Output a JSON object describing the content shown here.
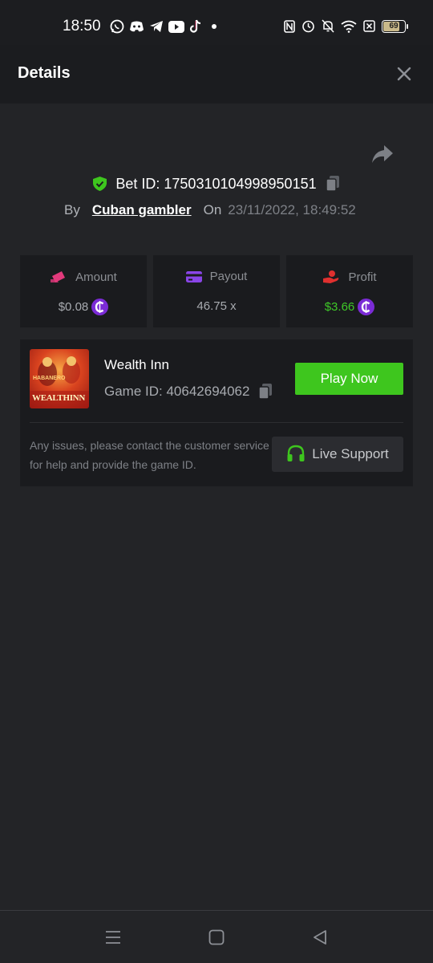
{
  "status_bar": {
    "time": "18:50",
    "battery": "69",
    "app_icons": [
      "whatsapp-icon",
      "discord-icon",
      "telegram-icon",
      "youtube-icon",
      "tiktok-icon"
    ],
    "system_icons": [
      "nfc-icon",
      "alarm-icon",
      "mute-icon",
      "wifi-icon",
      "sim-icon",
      "battery-icon"
    ]
  },
  "header": {
    "title": "Details"
  },
  "bet": {
    "bet_id": "Bet ID: 1750310104998950151",
    "by_label": "By",
    "username": "Cuban gambler",
    "on_label": "On",
    "date": "23/11/2022, 18:49:52"
  },
  "stats": [
    {
      "label": "Amount",
      "value": "$0.08",
      "icon": "amount-icon",
      "color": "#e23a7c"
    },
    {
      "label": "Payout",
      "value": "46.75 x",
      "icon": "payout-icon",
      "color": "#8a45e8"
    },
    {
      "label": "Profit",
      "value": "$3.66",
      "icon": "profit-icon",
      "color": "#e0302f"
    }
  ],
  "game": {
    "name": "Wealth Inn",
    "game_id": "Game ID: 40642694062",
    "thumb_brand": "HABANERO",
    "thumb_title": "WEALTHINN",
    "play_label": "Play Now",
    "issue_text": "Any issues, please contact the customer service for help and provide the game ID.",
    "support_label": "Live Support"
  },
  "colors": {
    "accent_green": "#3ec61e",
    "coin_purple": "#7b2bd6",
    "background": "#232427"
  }
}
